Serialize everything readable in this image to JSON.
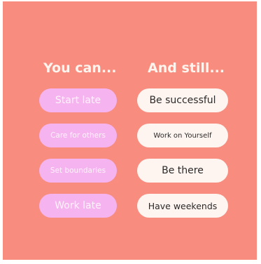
{
  "headings": {
    "left": "You can...",
    "right": "And still..."
  },
  "left_pills": [
    "Start late",
    "Care for others",
    "Set boundaries",
    "Work late"
  ],
  "right_pills": [
    "Be successful",
    "Work on Yourself",
    "Be there",
    "Have weekends"
  ],
  "colors": {
    "background": "#f88c7e",
    "left_pill": "#f5b3ef",
    "right_pill": "#fff5f0",
    "heading_text": "#fff5ee"
  }
}
